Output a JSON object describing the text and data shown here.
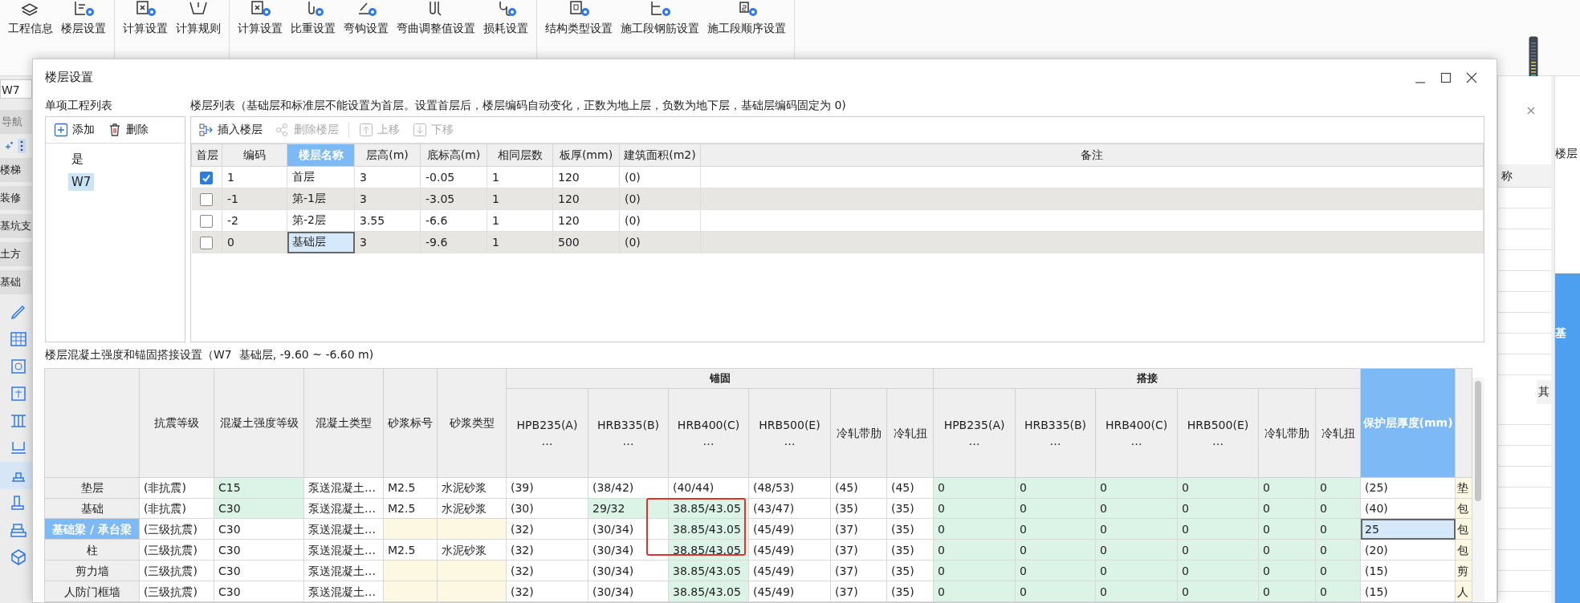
{
  "ribbon": {
    "groups": [
      {
        "items": [
          "工程信息",
          "楼层设置"
        ]
      },
      {
        "items": [
          "计算设置",
          "计算规则"
        ]
      },
      {
        "items": [
          "计算设置",
          "比重设置",
          "弯钩设置",
          "弯曲调整值设置",
          "损耗设置"
        ]
      },
      {
        "items": [
          "结构类型设置",
          "施工段钢筋设置",
          "施工段顺序设置"
        ]
      }
    ]
  },
  "navigator": {
    "project_field": "W7",
    "tab": "导航",
    "items": [
      "楼梯",
      "装修",
      "基坑支",
      "土方",
      "基础"
    ],
    "tools": [
      {
        "selected": false
      },
      {
        "selected": false
      },
      {
        "selected": false
      },
      {
        "selected": false
      },
      {
        "selected": false
      },
      {
        "selected": false
      },
      {
        "selected": true
      },
      {
        "selected": false
      },
      {
        "selected": false
      },
      {
        "selected": false
      }
    ]
  },
  "right_panel": {
    "column_header": "称",
    "side_label": "其",
    "panel_title": "楼层",
    "selected_cell": "基"
  },
  "dialog": {
    "title": "楼层设置",
    "project_list": {
      "label": "单项工程列表",
      "buttons": [
        "添加",
        "删除"
      ],
      "items": [
        {
          "label": "是",
          "selected": false
        },
        {
          "label": "W7",
          "selected": true
        }
      ]
    },
    "floor_list": {
      "label": "楼层列表（基础层和标准层不能设置为首层。设置首层后，楼层编码自动变化，正数为地上层，负数为地下层，基础层编码固定为 0)",
      "toolbar": [
        {
          "label": "插入楼层",
          "disabled": false
        },
        {
          "label": "删除楼层",
          "disabled": true
        },
        {
          "label": "上移",
          "disabled": true
        },
        {
          "label": "下移",
          "disabled": true
        }
      ],
      "checkbox_column": {
        "label": "首层",
        "selected": false
      },
      "columns": [
        {
          "label": "编码",
          "selected": false
        },
        {
          "label": "楼层名称",
          "selected": true
        },
        {
          "label": "层高(m)",
          "selected": false
        },
        {
          "label": "底标高(m)",
          "selected": false
        },
        {
          "label": "相同层数",
          "selected": false
        },
        {
          "label": "板厚(mm)",
          "selected": false
        },
        {
          "label": "建筑面积(m2)",
          "selected": false
        },
        {
          "label": "备注",
          "selected": false
        }
      ],
      "rows": [
        {
          "first_floor": true,
          "selected": false,
          "cells": [
            "1",
            "首层",
            "3",
            "-0.05",
            "1",
            "120",
            "(0)"
          ]
        },
        {
          "first_floor": false,
          "selected": false,
          "cells": [
            "-1",
            "第-1层",
            "3",
            "-3.05",
            "1",
            "120",
            "(0)"
          ]
        },
        {
          "first_floor": false,
          "selected": false,
          "cells": [
            "-2",
            "第-2层",
            "3.55",
            "-6.6",
            "1",
            "120",
            "(0)"
          ]
        },
        {
          "first_floor": false,
          "selected": true,
          "cells": [
            "0",
            "基础层",
            "3",
            "-9.6",
            "1",
            "500",
            "(0)"
          ]
        }
      ]
    },
    "settings_label": "楼层混凝土强度和锚固搭接设置（W7  基础层, -9.60 ~ -6.60 m)",
    "settings_table": {
      "header": [
        {
          "kind": "column",
          "label": "抗震等级",
          "selected": false
        },
        {
          "kind": "column",
          "label": "混凝土强度等级",
          "selected": false
        },
        {
          "kind": "column",
          "label": "混凝土类型",
          "selected": false
        },
        {
          "kind": "column",
          "label": "砂浆标号",
          "selected": false
        },
        {
          "kind": "column",
          "label": "砂浆类型",
          "selected": false
        },
        {
          "kind": "group",
          "label": "锚固",
          "columns": [
            {
              "label": "HPB235(A)",
              "more": "…",
              "selected": false
            },
            {
              "label": "HRB335(B)",
              "more": "…",
              "selected": false
            },
            {
              "label": "HRB400(C)",
              "more": "…",
              "selected": false
            },
            {
              "label": "HRB500(E)",
              "more": "…",
              "selected": false
            },
            {
              "label": "冷轧带肋",
              "selected": false
            },
            {
              "label": "冷轧扭",
              "selected": false
            }
          ]
        },
        {
          "kind": "group",
          "label": "搭接",
          "columns": [
            {
              "label": "HPB235(A)",
              "more": "…",
              "selected": false
            },
            {
              "label": "HRB335(B)",
              "more": "…",
              "selected": false
            },
            {
              "label": "HRB400(C)",
              "more": "…",
              "selected": false
            },
            {
              "label": "HRB500(E)",
              "more": "…",
              "selected": false
            },
            {
              "label": "冷轧带肋",
              "selected": false
            },
            {
              "label": "冷轧扭",
              "selected": false
            }
          ]
        },
        {
          "kind": "column",
          "label": "保护层厚度(mm)",
          "selected": true
        },
        {
          "kind": "blank",
          "selected": false
        }
      ],
      "rows": [
        {
          "label": "垫层",
          "selected": false,
          "cells": [
            {
              "text": "(非抗震)"
            },
            {
              "text": "C15",
              "color": "#dcf3e7"
            },
            {
              "text": "泵送混凝土…"
            },
            {
              "text": "M2.5"
            },
            {
              "text": "水泥砂浆"
            },
            {
              "text": "(39)"
            },
            {
              "text": "(38/42)"
            },
            {
              "text": "(40/44)"
            },
            {
              "text": "(48/53)"
            },
            {
              "text": "(45)"
            },
            {
              "text": "(45)"
            },
            {
              "text": "0",
              "color": "#dcf3e7"
            },
            {
              "text": "0",
              "color": "#dcf3e7"
            },
            {
              "text": "0",
              "color": "#dcf3e7"
            },
            {
              "text": "0",
              "color": "#dcf3e7"
            },
            {
              "text": "0",
              "color": "#dcf3e7"
            },
            {
              "text": "0",
              "color": "#dcf3e7"
            },
            {
              "text": "(25)"
            },
            {
              "text": "垫",
              "color": "#fdf8e1"
            }
          ]
        },
        {
          "label": "基础",
          "selected": false,
          "cells": [
            {
              "text": "(非抗震)"
            },
            {
              "text": "C30",
              "color": "#dcf3e7"
            },
            {
              "text": "泵送混凝土…"
            },
            {
              "text": "M2.5"
            },
            {
              "text": "水泥砂浆"
            },
            {
              "text": "(30)"
            },
            {
              "text": "29/32",
              "color": "#dcf3e7"
            },
            {
              "text": "38.85/43.05",
              "color": "#dcf3e7"
            },
            {
              "text": "(43/47)"
            },
            {
              "text": "(35)"
            },
            {
              "text": "(35)"
            },
            {
              "text": "0",
              "color": "#dcf3e7"
            },
            {
              "text": "0",
              "color": "#dcf3e7"
            },
            {
              "text": "0",
              "color": "#dcf3e7"
            },
            {
              "text": "0",
              "color": "#dcf3e7"
            },
            {
              "text": "0",
              "color": "#dcf3e7"
            },
            {
              "text": "0",
              "color": "#dcf3e7"
            },
            {
              "text": "(40)"
            },
            {
              "text": "包",
              "color": "#fdf8e1"
            }
          ]
        },
        {
          "label": "基础梁 / 承台梁",
          "selected": true,
          "cells": [
            {
              "text": "(三级抗震)"
            },
            {
              "text": "C30"
            },
            {
              "text": "泵送混凝土…"
            },
            {
              "color": "#fdf8e1"
            },
            {
              "color": "#fdf8e1"
            },
            {
              "text": "(32)"
            },
            {
              "text": "(30/34)"
            },
            {
              "text": "38.85/43.05",
              "color": "#dcf3e7"
            },
            {
              "text": "(45/49)"
            },
            {
              "text": "(37)"
            },
            {
              "text": "(35)"
            },
            {
              "text": "0",
              "color": "#dcf3e7"
            },
            {
              "text": "0",
              "color": "#dcf3e7"
            },
            {
              "text": "0",
              "color": "#dcf3e7"
            },
            {
              "text": "0",
              "color": "#dcf3e7"
            },
            {
              "text": "0",
              "color": "#dcf3e7"
            },
            {
              "text": "0",
              "color": "#dcf3e7"
            },
            {
              "text": "25"
            },
            {
              "text": "包",
              "color": "#fdf8e1"
            }
          ]
        },
        {
          "label": "柱",
          "selected": false,
          "cells": [
            {
              "text": "(三级抗震)"
            },
            {
              "text": "C30"
            },
            {
              "text": "泵送混凝土…"
            },
            {
              "text": "M2.5"
            },
            {
              "text": "水泥砂浆"
            },
            {
              "text": "(32)"
            },
            {
              "text": "(30/34)"
            },
            {
              "text": "38.85/43.05",
              "color": "#dcf3e7"
            },
            {
              "text": "(45/49)"
            },
            {
              "text": "(37)"
            },
            {
              "text": "(35)"
            },
            {
              "text": "0",
              "color": "#dcf3e7"
            },
            {
              "text": "0",
              "color": "#dcf3e7"
            },
            {
              "text": "0",
              "color": "#dcf3e7"
            },
            {
              "text": "0",
              "color": "#dcf3e7"
            },
            {
              "text": "0",
              "color": "#dcf3e7"
            },
            {
              "text": "0",
              "color": "#dcf3e7"
            },
            {
              "text": "(20)"
            },
            {
              "text": "包",
              "color": "#fdf8e1"
            }
          ]
        },
        {
          "label": "剪力墙",
          "selected": false,
          "cells": [
            {
              "text": "(三级抗震)"
            },
            {
              "text": "C30"
            },
            {
              "text": "泵送混凝土…"
            },
            {
              "color": "#fdf8e1"
            },
            {
              "color": "#fdf8e1"
            },
            {
              "text": "(32)"
            },
            {
              "text": "(30/34)"
            },
            {
              "text": "38.85/43.05",
              "color": "#dcf3e7"
            },
            {
              "text": "(45/49)"
            },
            {
              "text": "(37)"
            },
            {
              "text": "(35)"
            },
            {
              "text": "0",
              "color": "#dcf3e7"
            },
            {
              "text": "0",
              "color": "#dcf3e7"
            },
            {
              "text": "0",
              "color": "#dcf3e7"
            },
            {
              "text": "0",
              "color": "#dcf3e7"
            },
            {
              "text": "0",
              "color": "#dcf3e7"
            },
            {
              "text": "0",
              "color": "#dcf3e7"
            },
            {
              "text": "(15)"
            },
            {
              "text": "剪",
              "color": "#fdf8e1"
            }
          ]
        },
        {
          "label": "人防门框墙",
          "selected": false,
          "cells": [
            {
              "text": "(三级抗震)"
            },
            {
              "text": "C30"
            },
            {
              "text": "泵送混凝土…"
            },
            {
              "color": "#fdf8e1"
            },
            {
              "color": "#fdf8e1"
            },
            {
              "text": "(32)"
            },
            {
              "text": "(30/34)"
            },
            {
              "text": "38.85/43.05",
              "color": "#dcf3e7"
            },
            {
              "text": "(45/49)"
            },
            {
              "text": "(37)"
            },
            {
              "text": "(35)"
            },
            {
              "text": "0",
              "color": "#dcf3e7"
            },
            {
              "text": "0",
              "color": "#dcf3e7"
            },
            {
              "text": "0",
              "color": "#dcf3e7"
            },
            {
              "text": "0",
              "color": "#dcf3e7"
            },
            {
              "text": "0",
              "color": "#dcf3e7"
            },
            {
              "text": "0",
              "color": "#dcf3e7"
            },
            {
              "text": "(15)"
            },
            {
              "text": "人",
              "color": "#fdf8e1"
            }
          ]
        }
      ]
    }
  }
}
